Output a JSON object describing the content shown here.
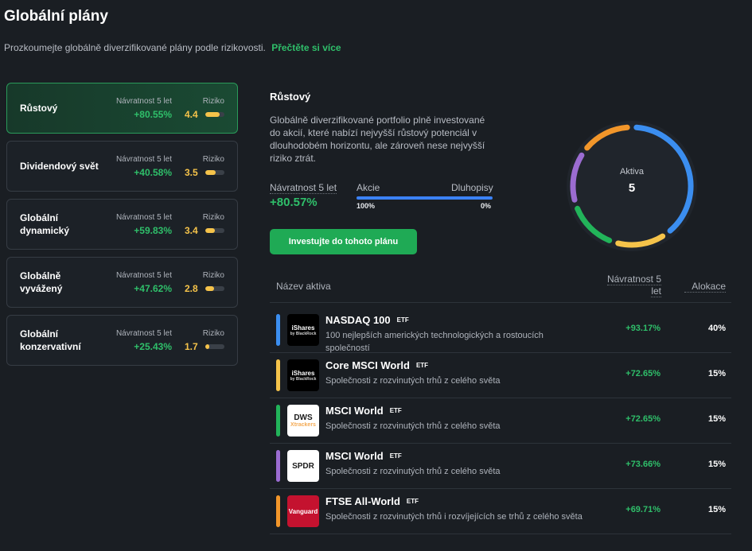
{
  "header": {
    "title": "Globální plány",
    "subtitle": "Prozkoumejte globálně diverzifikované plány podle rizikovosti.",
    "read_more": "Přečtěte si více"
  },
  "plans": [
    {
      "name": "Růstový",
      "return_label": "Návratnost 5 let",
      "return_value": "+80.55%",
      "risk_label": "Riziko",
      "risk_value": "4.4",
      "risk_level": 0.75,
      "active": true
    },
    {
      "name": "Dividendový svět",
      "return_label": "Návratnost 5 let",
      "return_value": "+40.58%",
      "risk_label": "Riziko",
      "risk_value": "3.5",
      "risk_level": 0.55,
      "active": false
    },
    {
      "name": "Globální dynamický",
      "return_label": "Návratnost 5 let",
      "return_value": "+59.83%",
      "risk_label": "Riziko",
      "risk_value": "3.4",
      "risk_level": 0.5,
      "active": false
    },
    {
      "name": "Globálně vyvážený",
      "return_label": "Návratnost 5 let",
      "return_value": "+47.62%",
      "risk_label": "Riziko",
      "risk_value": "2.8",
      "risk_level": 0.45,
      "active": false
    },
    {
      "name": "Globální konzervativní",
      "return_label": "Návratnost 5 let",
      "return_value": "+25.43%",
      "risk_label": "Riziko",
      "risk_value": "1.7",
      "risk_level": 0.2,
      "active": false
    }
  ],
  "detail": {
    "title": "Růstový",
    "description": "Globálně diverzifikované portfolio plně investované do akcií, které nabízí nejvyšší růstový potenciál v dlouhodobém horizontu, ale zároveň nese nejvyšší riziko ztrát.",
    "return_label": "Návratnost 5 let",
    "return_value": "+80.57%",
    "stocks_label": "Akcie",
    "bonds_label": "Dluhopisy",
    "stocks_value": "100%",
    "bonds_value": "0%",
    "stocks_fraction": 1.0,
    "invest_button": "Investujte do tohoto plánu",
    "donut_label": "Aktiva",
    "donut_value": "5"
  },
  "table": {
    "col_name": "Název aktiva",
    "col_return": "Návratnost 5 let",
    "col_alloc": "Alokace"
  },
  "assets": [
    {
      "name": "NASDAQ 100",
      "badge": "ETF",
      "description": "100 nejlepších amerických technologických a rostoucích společností",
      "return": "+93.17%",
      "allocation": "40%",
      "weight": 40,
      "color": "#3b8ef0",
      "logo": "iShares",
      "logo_sub": "by BlackRock",
      "logo_bg": "#000000",
      "logo_fg": "#ffffff"
    },
    {
      "name": "Core MSCI World",
      "badge": "ETF",
      "description": "Společnosti z rozvinutých trhů z celého světa",
      "return": "+72.65%",
      "allocation": "15%",
      "weight": 15,
      "color": "#f5c34a",
      "logo": "iShares",
      "logo_sub": "by BlackRock",
      "logo_bg": "#000000",
      "logo_fg": "#ffffff"
    },
    {
      "name": "MSCI World",
      "badge": "ETF",
      "description": "Společnosti z rozvinutých trhů z celého světa",
      "return": "+72.65%",
      "allocation": "15%",
      "weight": 15,
      "color": "#22b45a",
      "logo": "DWS",
      "logo_sub": "Xtrackers",
      "logo_bg": "#ffffff",
      "logo_fg": "#1a1a1a"
    },
    {
      "name": "MSCI World",
      "badge": "ETF",
      "description": "Společnosti z rozvinutých trhů z celého světa",
      "return": "+73.66%",
      "allocation": "15%",
      "weight": 15,
      "color": "#9b6cd1",
      "logo": "SPDR",
      "logo_sub": "",
      "logo_bg": "#ffffff",
      "logo_fg": "#1a1a1a"
    },
    {
      "name": "FTSE All-World",
      "badge": "ETF",
      "description": "Společnosti z rozvinutých trhů i rozvíjejících se trhů z celého světa",
      "return": "+69.71%",
      "allocation": "15%",
      "weight": 15,
      "color": "#f2962a",
      "logo": "Vanguard",
      "logo_sub": "",
      "logo_bg": "#c4122f",
      "logo_fg": "#ffffff"
    }
  ]
}
